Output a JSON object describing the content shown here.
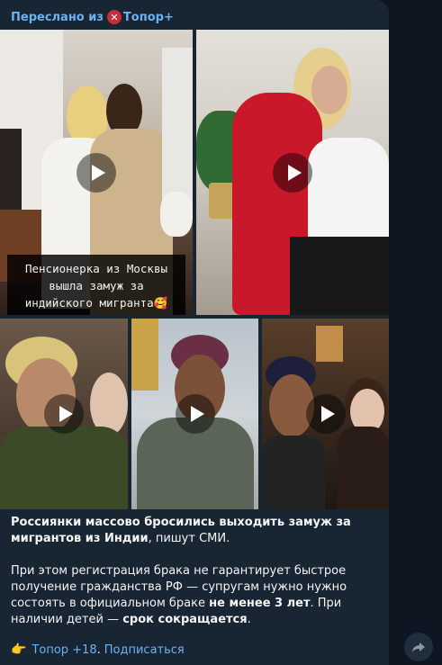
{
  "message": {
    "forwarded_prefix": "Переслано из",
    "channel_name": "Топор+",
    "accent": "#6ab3f3",
    "media": [
      {
        "id": "video-1",
        "caption_lines": [
          "Пенсионерка из Москвы",
          "вышла замуж за",
          "индийского мигранта"
        ]
      },
      {
        "id": "video-2"
      },
      {
        "id": "video-3"
      },
      {
        "id": "video-4"
      },
      {
        "id": "video-5"
      }
    ],
    "text": {
      "p1_bold": "Россиянки массово бросились выходить замуж за мигрантов из Индии",
      "p1_rest": ", пишут СМИ.",
      "p2_a": "При этом регистрация брака не гарантирует быстрое получение гражданства РФ — супругам нужно нужно состоять в официальном браке ",
      "p2_bold1": "не менее 3 лет",
      "p2_b": ". При наличии детей — ",
      "p2_bold2": "срок сокращается",
      "p2_c": "."
    },
    "footer": {
      "link1": "Топор +18",
      "sep": ".",
      "link2": "Подписаться"
    }
  }
}
